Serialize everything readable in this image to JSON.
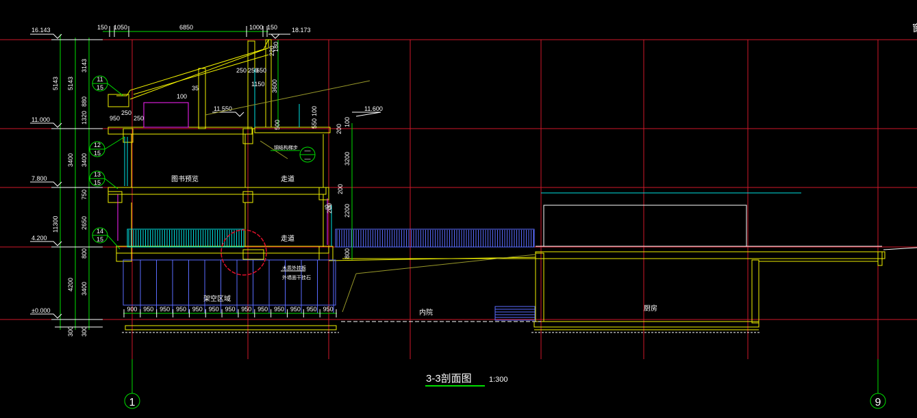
{
  "drawing": {
    "title": "3-3剖面图",
    "scale": "1:300",
    "axis_start": "1",
    "axis_end": "9",
    "corner_glyph": "窗"
  },
  "elevations": {
    "top_left": "16.143",
    "top_right": "18.173",
    "e11000": "11.000",
    "e7800": "7.800",
    "e4200": "4.200",
    "e0000": "±0.000",
    "e11550": "11.550",
    "e11600": "11.600"
  },
  "dims_top": [
    "150",
    "1050",
    "6850",
    "1000",
    "150"
  ],
  "dims_left_outer": [
    "5143",
    "11300",
    "4200",
    "300"
  ],
  "dims_left_inner": [
    "3143",
    "5143",
    "880",
    "1320",
    "3400",
    "3400",
    "750",
    "2650",
    "800",
    "3400",
    "300"
  ],
  "dims_right": [
    "180",
    "220",
    "3600",
    "100",
    "550",
    "200",
    "100",
    "3200",
    "200",
    "2200",
    "800"
  ],
  "dims_misc": [
    "250",
    "250",
    "650",
    "1150",
    "35",
    "100",
    "950",
    "250",
    "250",
    "90",
    "200",
    "500"
  ],
  "dims_bottom": [
    "900",
    "950",
    "950",
    "950",
    "950",
    "950",
    "950",
    "950",
    "950",
    "950",
    "950",
    "950",
    "950"
  ],
  "callouts": [
    {
      "top": "11",
      "bottom": "15"
    },
    {
      "top": "12",
      "bottom": "15"
    },
    {
      "top": "13",
      "bottom": "15"
    },
    {
      "top": "14",
      "bottom": "15"
    }
  ],
  "rooms": {
    "reading": "图书预览",
    "corridor_upper": "走道",
    "corridor_lower": "走道",
    "open_area": "架空区域",
    "courtyard": "内院",
    "kitchen": "厨房"
  },
  "notes": {
    "roof_detail": "钢结构梯步",
    "wood_note_1": "木质外挂板",
    "wood_note_2": "外墙面干挂石"
  },
  "colors": {
    "grid": "#d0182a",
    "structure": "#f2f200",
    "dimension": "#00e000",
    "glass": "#00e5e5",
    "railing": "#5a6cff",
    "furniture": "#ff22ff",
    "revision_cloud": "#e0102a"
  }
}
